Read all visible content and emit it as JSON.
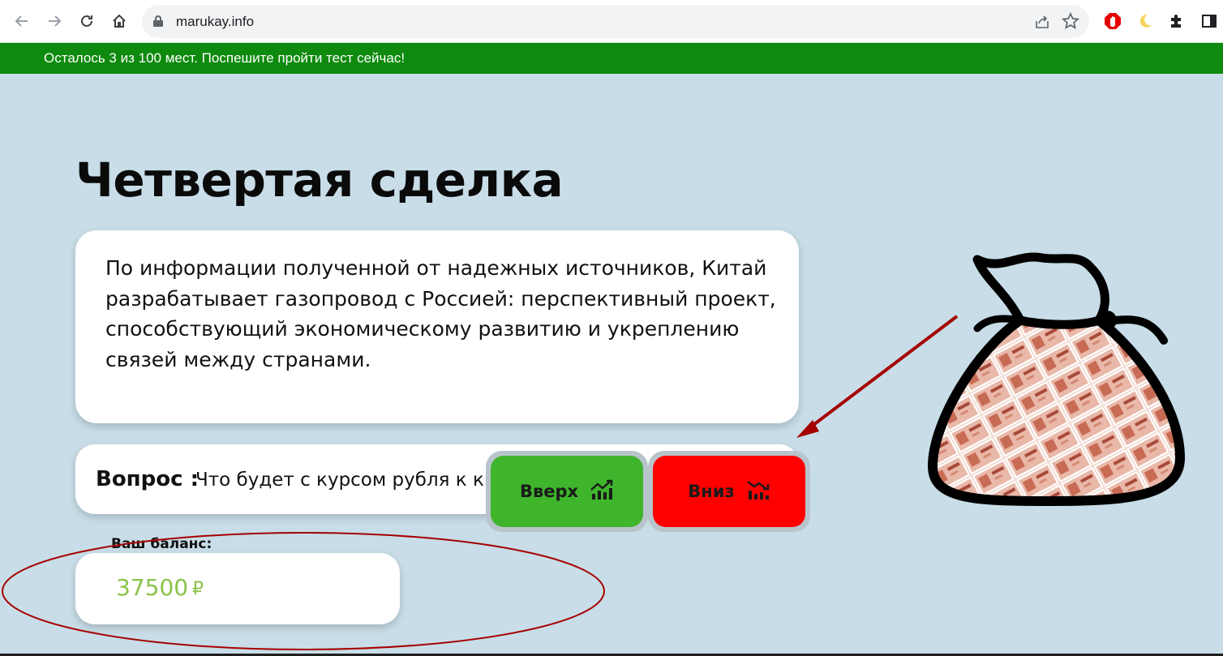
{
  "browser": {
    "url": "marukay.info",
    "icons": [
      "back-icon",
      "forward-icon",
      "reload-icon",
      "home-icon",
      "lock-icon",
      "share-icon",
      "star-icon",
      "adblock-extension-icon",
      "moon-extension-icon",
      "extensions-puzzle-icon",
      "side-panel-icon"
    ]
  },
  "banner": {
    "text": "Осталось 3 из 100 мест. Поспешите пройти тест сейчас!"
  },
  "page": {
    "title": "Четвертая сделка",
    "info_text": "По информации полученной от надежных источников, Китай разрабатывает газопровод с Россией: перспективный проект, способствующий экономическому развитию и укреплению связей между странами.",
    "question_label": "Вопрос :",
    "question_text": "Что будет с курсом рубля к китайскому юаню?",
    "up_button": {
      "label": "Вверх",
      "icon": "trend-up-icon",
      "color": "#3fb52c"
    },
    "down_button": {
      "label": "Вниз",
      "icon": "trend-down-icon",
      "color": "#ff0000"
    },
    "balance_label": "Ваш баланс:",
    "balance_value": "37500",
    "currency": "₽",
    "illustration": "money-bag-with-banknotes",
    "annotation_colors": {
      "arrow": "#a50000",
      "ellipse": "#a50000"
    }
  }
}
